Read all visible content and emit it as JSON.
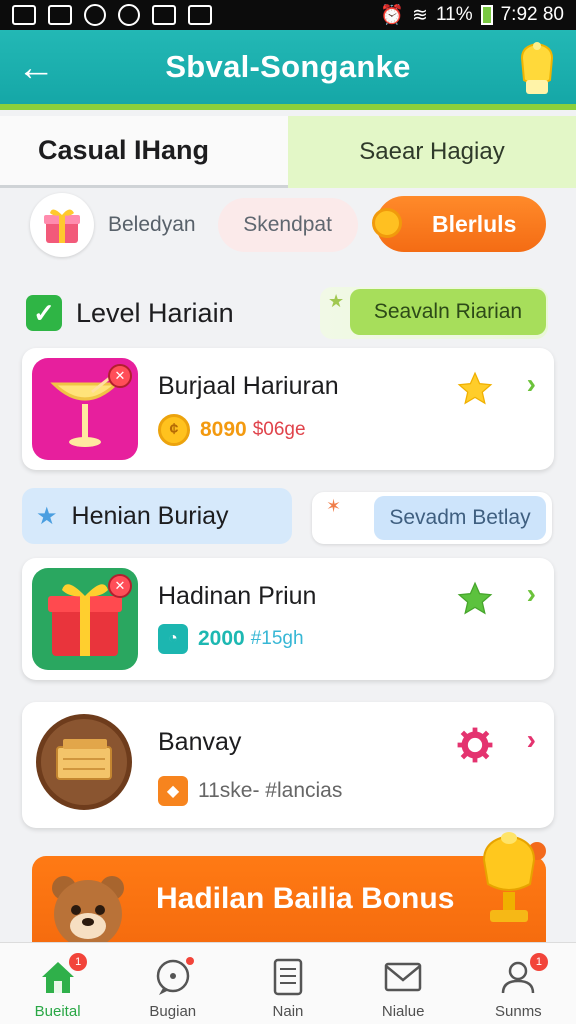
{
  "status_bar": {
    "battery": "11%",
    "time": "7:92 80"
  },
  "app_bar": {
    "title": "Sbval-Songanke"
  },
  "tabs": [
    {
      "label": "Casual IHang",
      "active": true
    },
    {
      "label": "Saear Hagiay",
      "active": false
    }
  ],
  "filters": {
    "label1": "Beledyan",
    "label2": "Skendpat",
    "button": "Blerluls"
  },
  "section1": {
    "title": "Level Hariain",
    "button": "Seavaln Riarian"
  },
  "cards": [
    {
      "title": "Burjaal Hariuran",
      "points": "8090",
      "extra": "$06ge"
    },
    {
      "title": "Hadinan Priun",
      "points": "2000",
      "extra": "#15gh"
    },
    {
      "title": "Banvay",
      "extra": "11ske- #lancias"
    }
  ],
  "section2": {
    "title": "Henian Buriay",
    "button": "Sevadm Betlay"
  },
  "banner": {
    "title": "Hadilan Bailia Bonus"
  },
  "bottom_nav": [
    {
      "label": "Bueital",
      "badge": "1",
      "active": true
    },
    {
      "label": "Bugian",
      "active": false
    },
    {
      "label": "Nain",
      "active": false
    },
    {
      "label": "Nialue",
      "active": false
    },
    {
      "label": "Sunms",
      "badge": "1",
      "active": false
    }
  ],
  "colors": {
    "app_bar": "#1aafad",
    "accent_green": "#8ad03c",
    "accent_orange": "#f47214",
    "accent_pink": "#e71f9d"
  }
}
